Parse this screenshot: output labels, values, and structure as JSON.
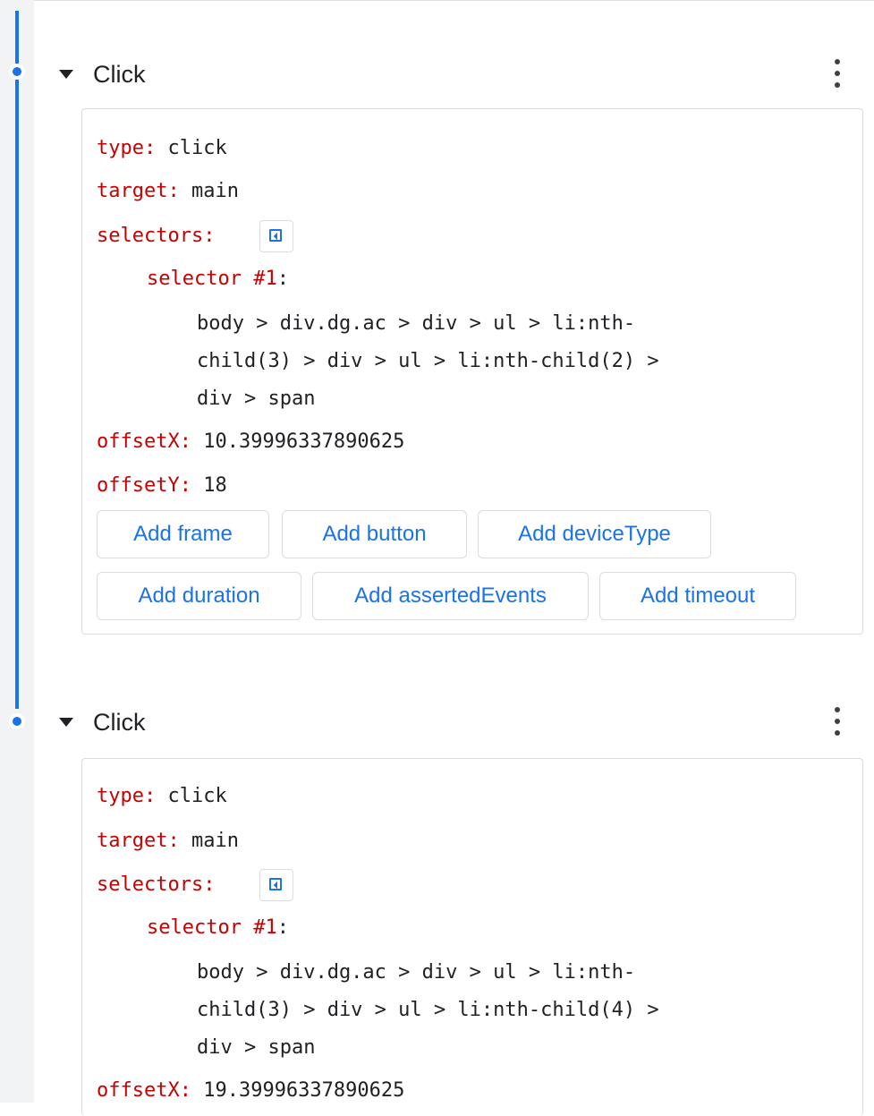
{
  "steps": [
    {
      "title": "Click",
      "fields": {
        "type": {
          "key": "type",
          "value": "click"
        },
        "target": {
          "key": "target",
          "value": "main"
        },
        "selectors": {
          "key": "selectors"
        },
        "selector": {
          "label": "selector #1",
          "lines": [
            "body > div.dg.ac > div > ul > li:nth-",
            "child(3) > div > ul > li:nth-child(2) >",
            "div > span"
          ]
        },
        "offsetX": {
          "key": "offsetX",
          "value": "10.39996337890625"
        },
        "offsetY": {
          "key": "offsetY",
          "value": "18"
        }
      },
      "buttons": [
        "Add frame",
        "Add button",
        "Add deviceType",
        "Add duration",
        "Add assertedEvents",
        "Add timeout"
      ]
    },
    {
      "title": "Click",
      "fields": {
        "type": {
          "key": "type",
          "value": "click"
        },
        "target": {
          "key": "target",
          "value": "main"
        },
        "selectors": {
          "key": "selectors"
        },
        "selector": {
          "label": "selector #1",
          "lines": [
            "body > div.dg.ac > div > ul > li:nth-",
            "child(3) > div > ul > li:nth-child(4) >",
            "div > span"
          ]
        },
        "offsetX": {
          "key": "offsetX",
          "value": "19.39996337890625"
        }
      }
    }
  ],
  "colors": {
    "accent": "#1a73e8",
    "key_red": "#c80000",
    "border": "#dadce0"
  },
  "icons": [
    "expand-caret-icon",
    "more-vert-icon",
    "element-picker-icon"
  ]
}
